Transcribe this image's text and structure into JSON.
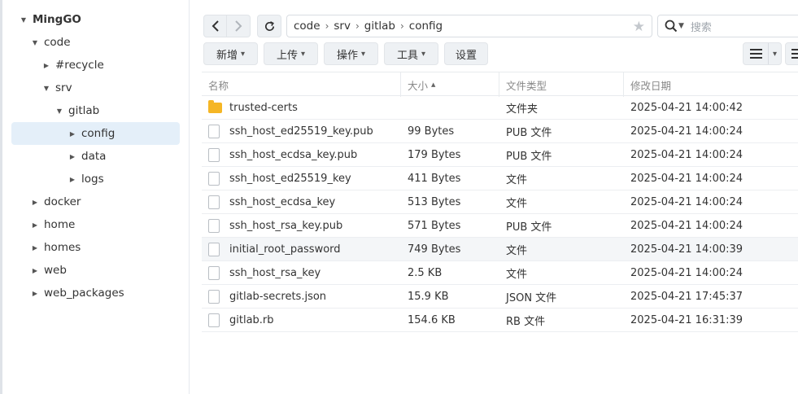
{
  "tree": {
    "root": "MingGO",
    "items": [
      {
        "label": "code",
        "level": 1,
        "expanded": true
      },
      {
        "label": "#recycle",
        "level": 2,
        "expanded": false
      },
      {
        "label": "srv",
        "level": 2,
        "expanded": true
      },
      {
        "label": "gitlab",
        "level": 3,
        "expanded": true
      },
      {
        "label": "config",
        "level": 4,
        "expanded": false,
        "selected": true
      },
      {
        "label": "data",
        "level": 4,
        "expanded": false
      },
      {
        "label": "logs",
        "level": 4,
        "expanded": false
      },
      {
        "label": "docker",
        "level": 1,
        "expanded": false
      },
      {
        "label": "home",
        "level": 1,
        "expanded": false
      },
      {
        "label": "homes",
        "level": 1,
        "expanded": false
      },
      {
        "label": "web",
        "level": 1,
        "expanded": false
      },
      {
        "label": "web_packages",
        "level": 1,
        "expanded": false
      }
    ]
  },
  "path": {
    "crumbs": [
      "code",
      "srv",
      "gitlab",
      "config"
    ],
    "separator": "›"
  },
  "search": {
    "placeholder": "搜索"
  },
  "toolbar": {
    "create_label": "新增",
    "upload_label": "上传",
    "action_label": "操作",
    "tools_label": "工具",
    "settings_label": "设置"
  },
  "table": {
    "headers": {
      "name": "名称",
      "size": "大小",
      "type": "文件类型",
      "modified": "修改日期"
    },
    "sort_indicator": "▲",
    "rows": [
      {
        "name": "trusted-certs",
        "size": "",
        "type": "文件夹",
        "modified": "2025-04-21 14:00:42",
        "icon": "folder-icon"
      },
      {
        "name": "ssh_host_ed25519_key.pub",
        "size": "99 Bytes",
        "type": "PUB 文件",
        "modified": "2025-04-21 14:00:24",
        "icon": "file-icon"
      },
      {
        "name": "ssh_host_ecdsa_key.pub",
        "size": "179 Bytes",
        "type": "PUB 文件",
        "modified": "2025-04-21 14:00:24",
        "icon": "file-icon"
      },
      {
        "name": "ssh_host_ed25519_key",
        "size": "411 Bytes",
        "type": "文件",
        "modified": "2025-04-21 14:00:24",
        "icon": "file-icon"
      },
      {
        "name": "ssh_host_ecdsa_key",
        "size": "513 Bytes",
        "type": "文件",
        "modified": "2025-04-21 14:00:24",
        "icon": "file-icon"
      },
      {
        "name": "ssh_host_rsa_key.pub",
        "size": "571 Bytes",
        "type": "PUB 文件",
        "modified": "2025-04-21 14:00:24",
        "icon": "file-icon"
      },
      {
        "name": "initial_root_password",
        "size": "749 Bytes",
        "type": "文件",
        "modified": "2025-04-21 14:00:39",
        "icon": "file-icon",
        "hover": true
      },
      {
        "name": "ssh_host_rsa_key",
        "size": "2.5 KB",
        "type": "文件",
        "modified": "2025-04-21 14:00:24",
        "icon": "file-icon"
      },
      {
        "name": "gitlab-secrets.json",
        "size": "15.9 KB",
        "type": "JSON 文件",
        "modified": "2025-04-21 17:45:37",
        "icon": "file-icon"
      },
      {
        "name": "gitlab.rb",
        "size": "154.6 KB",
        "type": "RB 文件",
        "modified": "2025-04-21 16:31:39",
        "icon": "file-icon"
      }
    ]
  },
  "colors": {
    "selected_bg": "#e4eff9",
    "folder": "#f5b625",
    "button_bg": "#eef1f4"
  }
}
